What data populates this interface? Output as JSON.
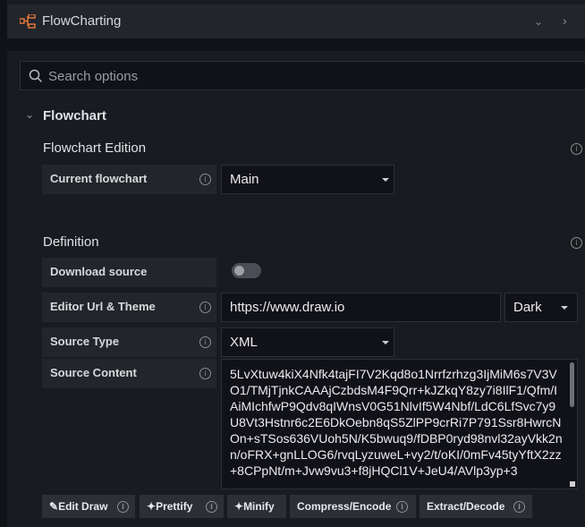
{
  "header": {
    "title": "FlowCharting",
    "collapse_icon": "chevron-down-icon",
    "next_icon": "chevron-right-icon"
  },
  "search": {
    "placeholder": "Search options"
  },
  "section": {
    "title": "Flowchart",
    "expanded": true
  },
  "edition": {
    "title": "Flowchart Edition",
    "current_label": "Current flowchart",
    "current_value": "Main"
  },
  "definition": {
    "title": "Definition",
    "download_label": "Download source",
    "download_enabled": false,
    "editor_label": "Editor Url & Theme",
    "editor_url": "https://www.draw.io",
    "editor_theme": "Dark",
    "source_type_label": "Source Type",
    "source_type_value": "XML",
    "source_content_label": "Source Content",
    "source_content_value": "5LvXtuw4kiX4Nfk4tajFI7V2Kqd8o1Nrrfzrhzg3IjMiM6s7V3VO1/TMjTjnkCAAAjCzbdsM4F9Qrr+kJZkqY8zy7i8IlF1/Qfm/IAiMIchfwP9Qdv8qIWnsV0G51NlvIf5W4Nbf/LdC6LfSvc7y9U8Vt3Hstnr6c2E6DkOebn8qS5ZlPP9crRi7P791Ssr8HwrcNOn+sTSos636VUoh5N/K5bwuq9/fDBP0ryd98nvl32ayVkk2nn/oFRX+gnLLOG6/rvqLyzuweL+vy2/t/oKI/0mFv45tyYftX2zz+8CPpNt/m+Jvw9vu3+f8jHQCl1V+JeU4/AVlp3yp+3"
  },
  "buttons": {
    "edit_draw": "Edit Draw",
    "prettify": "Prettify",
    "minify": "Minify",
    "compress": "Compress/Encode",
    "extract": "Extract/Decode"
  },
  "info_glyph": "i",
  "colors": {
    "panel_bg": "#181b1f",
    "page_bg": "#111217",
    "label_bg": "#22252b",
    "button_bg": "#2c3036"
  }
}
